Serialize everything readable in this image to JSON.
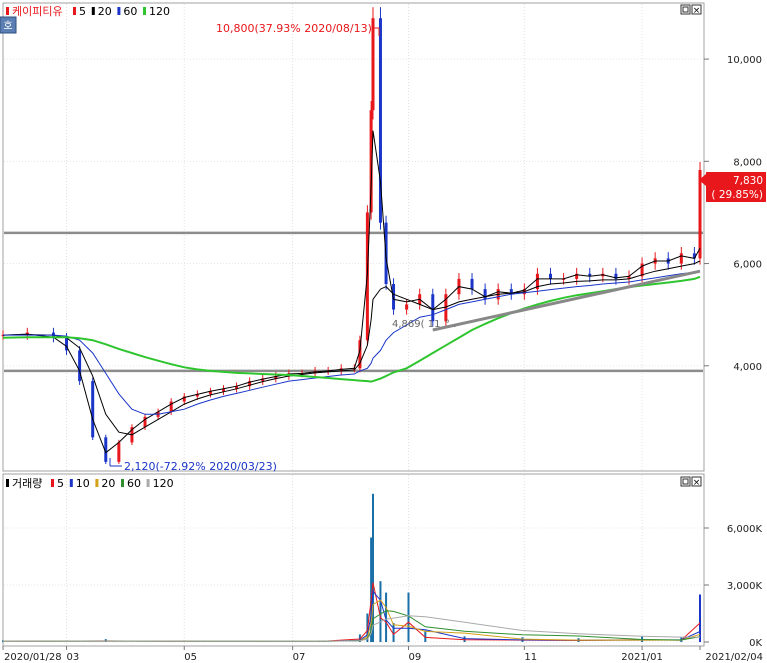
{
  "colors": {
    "up": "#e8171b",
    "down": "#1a35c8",
    "ma5": "#000000",
    "ma20": "#000000",
    "ma60": "#1a35c8",
    "ma120": "#2ec52e",
    "trend": "#888888",
    "hline": "#8c8c8c",
    "vol10": "#1a35c8",
    "vol20": "#d4a017",
    "vol60": "#2f8f2f",
    "vol120": "#aaaaaa",
    "badge": "#e8171b"
  },
  "price_panel": {
    "legend": [
      {
        "label": "케이피티유",
        "color": "#e8171b"
      },
      {
        "label": "5",
        "color": "#e8171b"
      },
      {
        "label": "20",
        "color": "#000000"
      },
      {
        "label": "60",
        "color": "#1a35c8"
      },
      {
        "label": "120",
        "color": "#2ec52e"
      }
    ],
    "high_annotation": "10,800(37.93% 2020/08/13)",
    "low_annotation": "2,120(-72.92% 2020/03/23)",
    "mid_annotation": "4,869( 11",
    "last_price": "7,830",
    "last_change": "( 29.85%)",
    "side_icon": "호"
  },
  "volume_panel": {
    "legend": [
      {
        "label": "거래량",
        "color": "#000000"
      },
      {
        "label": "5",
        "color": "#e8171b"
      },
      {
        "label": "10",
        "color": "#1a35c8"
      },
      {
        "label": "20",
        "color": "#d4a017"
      },
      {
        "label": "60",
        "color": "#2f8f2f"
      },
      {
        "label": "120",
        "color": "#aaaaaa"
      }
    ]
  },
  "window_icons": [
    "maximize-icon",
    "close-icon"
  ],
  "chart_data": [
    {
      "type": "candlestick",
      "title": "케이피티유",
      "x_tick_labels": [
        "2020/01/28",
        "03",
        "05",
        "07",
        "09",
        "11",
        "2021/01",
        "2021/02/04"
      ],
      "y_tick_labels": [
        "4,000",
        "6,000",
        "8,000",
        "10,000"
      ],
      "ylim": [
        2000,
        11000
      ],
      "horizontal_lines": [
        3900,
        6600
      ],
      "trendline": {
        "from": {
          "date": "2020/09/14",
          "value": 4700
        },
        "to": {
          "date": "2021/02/04",
          "value": 5850
        }
      },
      "series": [
        {
          "name": "close",
          "dates": [
            "2020/01/28",
            "2020/02/10",
            "2020/02/24",
            "2020/03/02",
            "2020/03/09",
            "2020/03/16",
            "2020/03/23",
            "2020/03/30",
            "2020/04/06",
            "2020/04/13",
            "2020/04/20",
            "2020/04/27",
            "2020/05/04",
            "2020/05/11",
            "2020/05/18",
            "2020/05/25",
            "2020/06/01",
            "2020/06/08",
            "2020/06/15",
            "2020/06/22",
            "2020/06/29",
            "2020/07/06",
            "2020/07/13",
            "2020/07/20",
            "2020/07/27",
            "2020/08/03",
            "2020/08/06",
            "2020/08/10",
            "2020/08/12",
            "2020/08/13",
            "2020/08/17",
            "2020/08/20",
            "2020/08/24",
            "2020/08/31",
            "2020/09/07",
            "2020/09/14",
            "2020/09/21",
            "2020/09/28",
            "2020/10/05",
            "2020/10/12",
            "2020/10/19",
            "2020/10/26",
            "2020/11/02",
            "2020/11/09",
            "2020/11/16",
            "2020/11/23",
            "2020/11/30",
            "2020/12/07",
            "2020/12/14",
            "2020/12/21",
            "2020/12/28",
            "2021/01/04",
            "2021/01/11",
            "2021/01/18",
            "2021/01/25",
            "2021/02/01",
            "2021/02/04"
          ],
          "values": [
            4600,
            4650,
            4550,
            4300,
            3700,
            2600,
            2120,
            2500,
            2800,
            3000,
            3100,
            3300,
            3400,
            3450,
            3500,
            3550,
            3600,
            3700,
            3750,
            3800,
            3850,
            3850,
            3900,
            3900,
            3950,
            3950,
            4500,
            7000,
            9000,
            10800,
            6800,
            5600,
            5100,
            5200,
            5400,
            4870,
            5400,
            5700,
            5500,
            5300,
            5500,
            5400,
            5500,
            5800,
            5700,
            5700,
            5800,
            5750,
            5800,
            5700,
            5750,
            6000,
            6100,
            6000,
            6200,
            6100,
            7830
          ]
        }
      ],
      "moving_averages": [
        {
          "name": "5",
          "values": [
            4600,
            4620,
            4560,
            4380,
            3900,
            2950,
            2300,
            2500,
            2750,
            2950,
            3100,
            3250,
            3380,
            3440,
            3500,
            3550,
            3600,
            3680,
            3740,
            3790,
            3840,
            3850,
            3880,
            3900,
            3930,
            3950,
            4300,
            5800,
            7500,
            8600,
            7600,
            6100,
            5300,
            5250,
            5300,
            5100,
            5300,
            5550,
            5500,
            5350,
            5450,
            5420,
            5480,
            5700,
            5700,
            5700,
            5780,
            5750,
            5780,
            5720,
            5750,
            5950,
            6050,
            6050,
            6150,
            6100,
            6300
          ]
        },
        {
          "name": "20",
          "values": [
            4600,
            4610,
            4600,
            4550,
            4350,
            3800,
            3050,
            2700,
            2650,
            2800,
            2950,
            3100,
            3250,
            3350,
            3430,
            3490,
            3550,
            3620,
            3690,
            3750,
            3800,
            3830,
            3860,
            3880,
            3900,
            3920,
            4050,
            4400,
            4900,
            5300,
            5500,
            5550,
            5400,
            5300,
            5200,
            5100,
            5150,
            5250,
            5300,
            5350,
            5400,
            5420,
            5450,
            5550,
            5600,
            5620,
            5650,
            5660,
            5680,
            5680,
            5700,
            5780,
            5850,
            5900,
            5950,
            6000,
            6050
          ]
        },
        {
          "name": "60",
          "values": [
            4600,
            4600,
            4600,
            4580,
            4500,
            4250,
            3850,
            3450,
            3150,
            3050,
            3050,
            3100,
            3150,
            3250,
            3330,
            3400,
            3460,
            3520,
            3580,
            3640,
            3700,
            3730,
            3760,
            3790,
            3820,
            3840,
            3900,
            3950,
            4050,
            4150,
            4300,
            4500,
            4650,
            4800,
            4950,
            5000,
            5100,
            5200,
            5250,
            5300,
            5350,
            5400,
            5430,
            5460,
            5490,
            5520,
            5550,
            5570,
            5600,
            5620,
            5640,
            5680,
            5720,
            5760,
            5800,
            5830,
            5860
          ]
        },
        {
          "name": "120",
          "values": [
            4550,
            4560,
            4560,
            4560,
            4540,
            4500,
            4420,
            4330,
            4250,
            4170,
            4100,
            4030,
            3970,
            3930,
            3900,
            3880,
            3860,
            3850,
            3840,
            3830,
            3820,
            3800,
            3780,
            3760,
            3740,
            3720,
            3710,
            3700,
            3690,
            3700,
            3750,
            3800,
            3870,
            3950,
            4100,
            4250,
            4400,
            4550,
            4700,
            4820,
            4930,
            5030,
            5120,
            5200,
            5270,
            5330,
            5380,
            5420,
            5460,
            5500,
            5540,
            5570,
            5600,
            5630,
            5660,
            5700,
            5740
          ]
        }
      ]
    },
    {
      "type": "bar",
      "title": "거래량",
      "x_tick_labels": [
        "2020/01/28",
        "03",
        "05",
        "07",
        "09",
        "11",
        "2021/01",
        "2021/02/04"
      ],
      "y_tick_labels": [
        "0K",
        "3,000K",
        "6,000K"
      ],
      "ylim": [
        0,
        8000
      ],
      "series": [
        {
          "name": "volume",
          "dates": [
            "2020/01/28",
            "2020/03/23",
            "2020/05/15",
            "2020/07/15",
            "2020/08/06",
            "2020/08/10",
            "2020/08/12",
            "2020/08/13",
            "2020/08/17",
            "2020/08/20",
            "2020/08/24",
            "2020/09/01",
            "2020/09/10",
            "2020/10/01",
            "2020/11/01",
            "2020/12/01",
            "2021/01/04",
            "2021/01/25",
            "2021/02/04"
          ],
          "values": [
            80,
            150,
            60,
            70,
            400,
            1500,
            5500,
            7800,
            3200,
            2600,
            1000,
            2600,
            600,
            300,
            250,
            200,
            300,
            250,
            2500
          ]
        }
      ]
    }
  ]
}
